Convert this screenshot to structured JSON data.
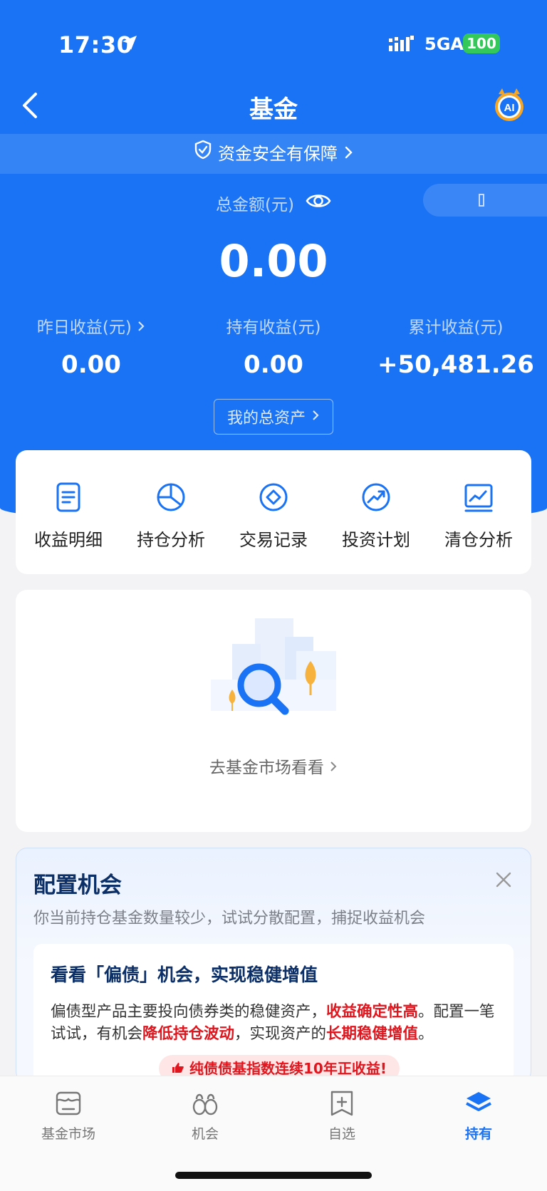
{
  "status_bar": {
    "time": "17:30",
    "network": "5GA",
    "battery": "100"
  },
  "nav": {
    "title": "基金",
    "ai_badge": "AI"
  },
  "safety_banner": {
    "text": "资金安全有保障"
  },
  "total": {
    "label": "总金额(元)",
    "value": "0.00"
  },
  "stats": [
    {
      "label": "昨日收益(元)",
      "value": "0.00"
    },
    {
      "label": "持有收益(元)",
      "value": "0.00"
    },
    {
      "label": "累计收益(元)",
      "value": "+50,481.26"
    }
  ],
  "assets_button": {
    "label": "我的总资产"
  },
  "tools": [
    {
      "label": "收益明细",
      "icon": "document-icon"
    },
    {
      "label": "持仓分析",
      "icon": "pie-chart-icon"
    },
    {
      "label": "交易记录",
      "icon": "diamond-icon"
    },
    {
      "label": "投资计划",
      "icon": "trend-up-icon"
    },
    {
      "label": "清仓分析",
      "icon": "chart-board-icon"
    }
  ],
  "empty_state": {
    "link": "去基金市场看看"
  },
  "config": {
    "title": "配置机会",
    "subtitle": "你当前持仓基金数量较少，试试分散配置，捕捉收益机会",
    "card_title": "看看「偏债」机会，实现稳健增值",
    "body_1": "偏债型产品主要投向债券类的稳健资产，",
    "hl_1": "收益确定性高",
    "body_2": "。配置一笔试试，有机会",
    "hl_2": "降低持仓波动",
    "body_3": "，实现资产的",
    "hl_3": "长期稳健增值",
    "body_4": "。",
    "badge": "纯债债基指数连续10年正收益!"
  },
  "tabbar": [
    {
      "label": "基金市场",
      "icon": "market-icon",
      "active": false
    },
    {
      "label": "机会",
      "icon": "binoculars-icon",
      "active": false
    },
    {
      "label": "自选",
      "icon": "add-favorite-icon",
      "active": false
    },
    {
      "label": "持有",
      "icon": "layers-icon",
      "active": true
    }
  ],
  "colors": {
    "brand": "#1a73f5",
    "highlight": "#e0161e",
    "title_navy": "#0b2f66"
  }
}
